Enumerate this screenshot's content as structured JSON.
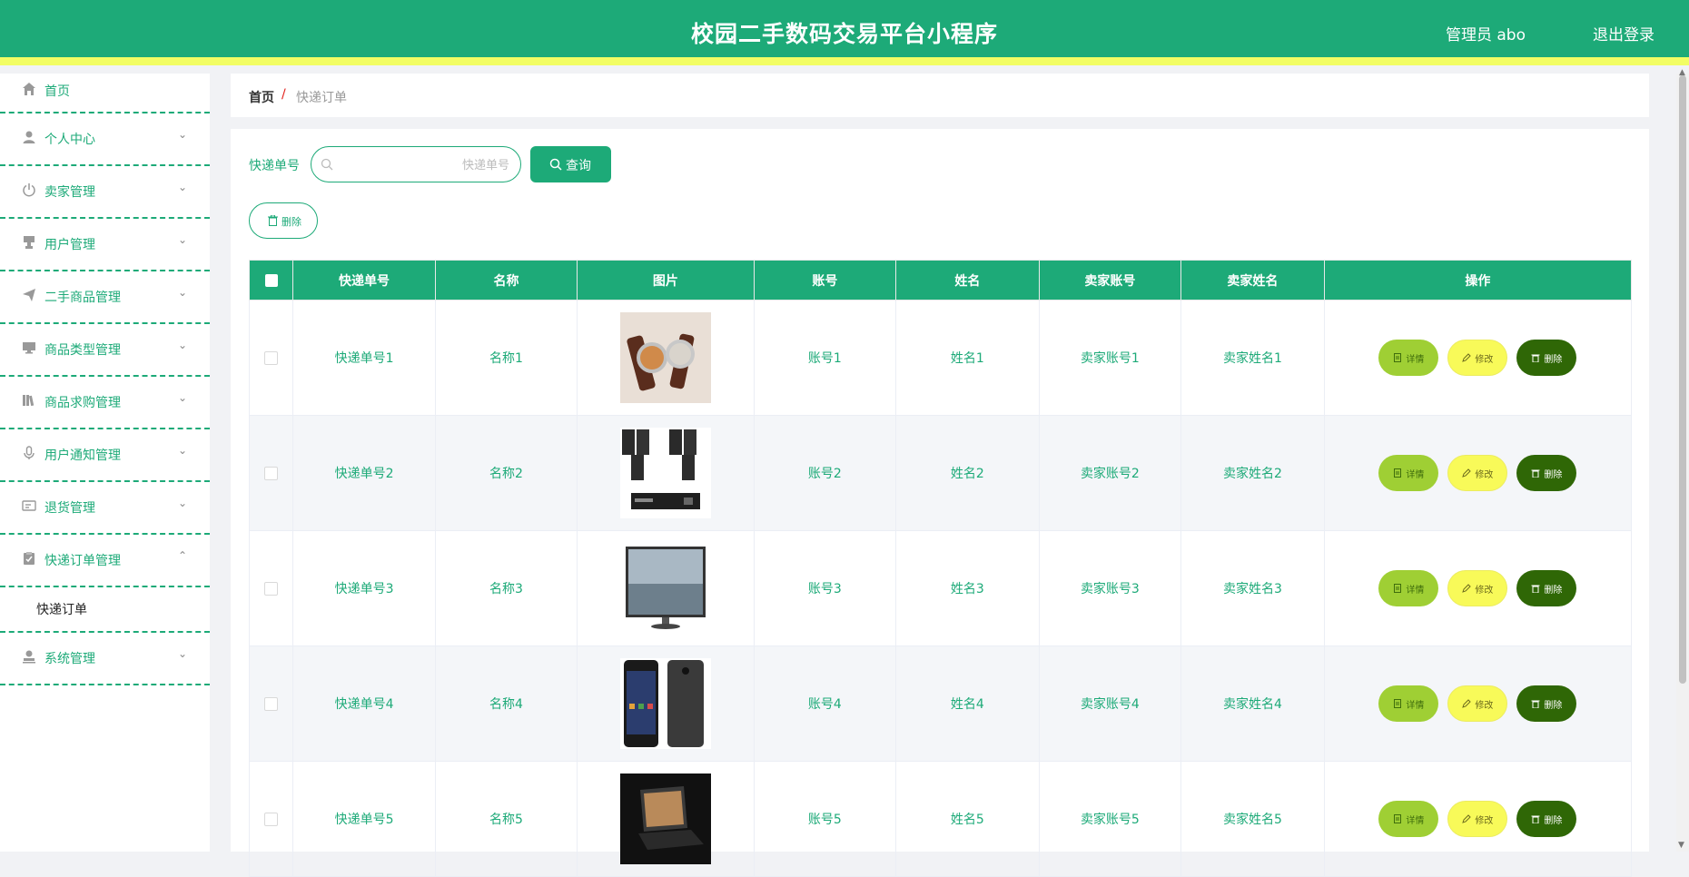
{
  "header": {
    "title": "校园二手数码交易平台小程序",
    "user": "管理员 abo",
    "logout": "退出登录"
  },
  "sidebar": {
    "items": [
      {
        "label": "首页",
        "icon": "home-icon"
      },
      {
        "label": "个人中心",
        "icon": "person-icon"
      },
      {
        "label": "卖家管理",
        "icon": "power-icon"
      },
      {
        "label": "用户管理",
        "icon": "stamp-icon"
      },
      {
        "label": "二手商品管理",
        "icon": "send-icon"
      },
      {
        "label": "商品类型管理",
        "icon": "monitor-icon"
      },
      {
        "label": "商品求购管理",
        "icon": "books-icon"
      },
      {
        "label": "用户通知管理",
        "icon": "microphone-icon"
      },
      {
        "label": "退货管理",
        "icon": "card-icon"
      },
      {
        "label": "快递订单管理",
        "icon": "clipboard-check-icon"
      },
      {
        "label": "系统管理",
        "icon": "user-stamp-icon"
      }
    ],
    "active_sub": "快递订单"
  },
  "breadcrumb": {
    "home": "首页",
    "separator": "/",
    "current": "快递订单"
  },
  "search": {
    "label": "快递单号",
    "placeholder": "快递单号",
    "value": "",
    "button": "查询"
  },
  "toolbar": {
    "delete": "删除"
  },
  "table": {
    "columns": [
      "快递单号",
      "名称",
      "图片",
      "账号",
      "姓名",
      "卖家账号",
      "卖家姓名",
      "操作"
    ],
    "rows": [
      {
        "express_no": "快递单号1",
        "name": "名称1",
        "image": "watch-image",
        "account": "账号1",
        "real_name": "姓名1",
        "seller_account": "卖家账号1",
        "seller_name": "卖家姓名1"
      },
      {
        "express_no": "快递单号2",
        "name": "名称2",
        "image": "speaker-image",
        "account": "账号2",
        "real_name": "姓名2",
        "seller_account": "卖家账号2",
        "seller_name": "卖家姓名2"
      },
      {
        "express_no": "快递单号3",
        "name": "名称3",
        "image": "monitor-image",
        "account": "账号3",
        "real_name": "姓名3",
        "seller_account": "卖家账号3",
        "seller_name": "卖家姓名3"
      },
      {
        "express_no": "快递单号4",
        "name": "名称4",
        "image": "phone-image",
        "account": "账号4",
        "real_name": "姓名4",
        "seller_account": "卖家账号4",
        "seller_name": "卖家姓名4"
      },
      {
        "express_no": "快递单号5",
        "name": "名称5",
        "image": "laptop-image",
        "account": "账号5",
        "real_name": "姓名5",
        "seller_account": "卖家账号5",
        "seller_name": "卖家姓名5"
      }
    ],
    "actions": {
      "detail": "详情",
      "edit": "修改",
      "delete": "删除"
    }
  },
  "colors": {
    "primary": "#1daa78",
    "header_accent": "#f2fd64",
    "detail_btn": "#9fcf34",
    "edit_btn": "#f8fa59",
    "delete_btn": "#2f6706"
  }
}
